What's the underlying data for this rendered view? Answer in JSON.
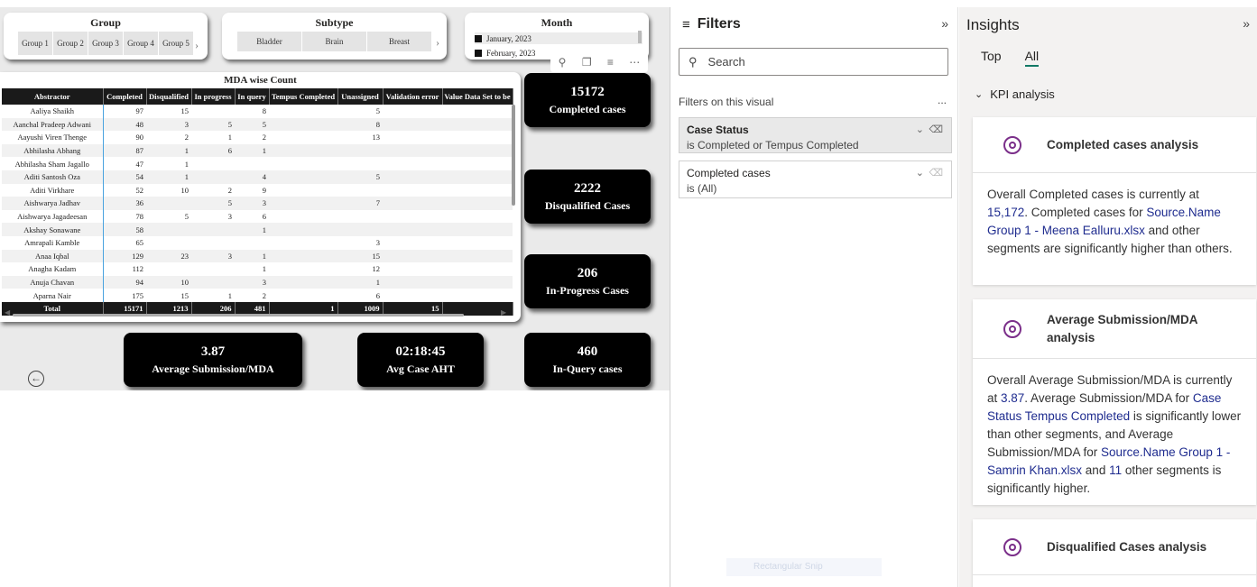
{
  "slicers": {
    "group": {
      "title": "Group",
      "items": [
        "Group 1",
        "Group 2",
        "Group 3",
        "Group 4",
        "Group 5"
      ]
    },
    "subtype": {
      "title": "Subtype",
      "items": [
        "Bladder",
        "Brain",
        "Breast"
      ]
    },
    "month": {
      "title": "Month",
      "items": [
        "January, 2023",
        "February, 2023"
      ]
    }
  },
  "table": {
    "title": "MDA wise Count",
    "columns": [
      "Abstractor",
      "Completed",
      "Disqualified",
      "In progress",
      "In query",
      "Tempus Completed",
      "Unassigned",
      "Validation error",
      "Value Data Set to be"
    ],
    "rows": [
      [
        "Aaliya Shaikh",
        "97",
        "15",
        "",
        "8",
        "",
        "5",
        "",
        ""
      ],
      [
        "Aanchal Pradeep Adwani",
        "48",
        "3",
        "5",
        "5",
        "",
        "8",
        "",
        ""
      ],
      [
        "Aayushi Viren Thenge",
        "90",
        "2",
        "1",
        "2",
        "",
        "13",
        "",
        ""
      ],
      [
        "Abhilasha Abhang",
        "87",
        "1",
        "6",
        "1",
        "",
        "",
        "",
        ""
      ],
      [
        "Abhilasha Sham Jagallo",
        "47",
        "1",
        "",
        "",
        "",
        "",
        "",
        ""
      ],
      [
        "Aditi Santosh Oza",
        "54",
        "1",
        "",
        "4",
        "",
        "5",
        "",
        ""
      ],
      [
        "Aditi Virkhare",
        "52",
        "10",
        "2",
        "9",
        "",
        "",
        "",
        ""
      ],
      [
        "Aishwarya Jadhav",
        "36",
        "",
        "5",
        "3",
        "",
        "7",
        "",
        ""
      ],
      [
        "Aishwarya Jagadeesan",
        "78",
        "5",
        "3",
        "6",
        "",
        "",
        "",
        ""
      ],
      [
        "Akshay Sonawane",
        "58",
        "",
        "",
        "1",
        "",
        "",
        "",
        ""
      ],
      [
        "Amrapali Kamble",
        "65",
        "",
        "",
        "",
        "",
        "3",
        "",
        ""
      ],
      [
        "Anaa Iqbal",
        "129",
        "23",
        "3",
        "1",
        "",
        "15",
        "",
        ""
      ],
      [
        "Anagha Kadam",
        "112",
        "",
        "",
        "1",
        "",
        "12",
        "",
        ""
      ],
      [
        "Anuja Chavan",
        "94",
        "10",
        "",
        "3",
        "",
        "1",
        "",
        ""
      ],
      [
        "Aparna Nair",
        "175",
        "15",
        "1",
        "2",
        "",
        "6",
        "",
        ""
      ]
    ],
    "total": [
      "Total",
      "15171",
      "1213",
      "206",
      "481",
      "1",
      "1009",
      "15",
      ""
    ]
  },
  "kpis": {
    "completed": {
      "value": "15172",
      "label": "Completed cases"
    },
    "disqualified": {
      "value": "2222",
      "label": "Disqualified Cases"
    },
    "in_progress": {
      "value": "206",
      "label": "In-Progress Cases"
    },
    "in_query": {
      "value": "460",
      "label": "In-Query cases"
    },
    "avg_sub": {
      "value": "3.87",
      "label": "Average Submission/MDA"
    },
    "aht": {
      "value": "02:18:45",
      "label": "Avg Case AHT"
    }
  },
  "filters": {
    "title": "Filters",
    "search_placeholder": "Search",
    "section": "Filters on this visual",
    "more": "...",
    "cards": [
      {
        "title": "Case Status",
        "subtitle": "is Completed or Tempus Completed"
      },
      {
        "title": "Completed cases",
        "subtitle": "is (All)"
      }
    ]
  },
  "insights": {
    "title": "Insights",
    "tabs": [
      "Top",
      "All"
    ],
    "section": "KPI analysis",
    "cards": [
      {
        "title": "Completed cases analysis",
        "body": [
          {
            "t": "Overall Completed cases is currently at "
          },
          {
            "t": "15,172",
            "h": true
          },
          {
            "t": ". Completed cases for "
          },
          {
            "t": "Source.Name Group 1 - Meena Ealluru.xlsx",
            "h": true
          },
          {
            "t": " and other segments are significantly higher than others."
          }
        ]
      },
      {
        "title": "Average Submission/MDA analysis",
        "body": [
          {
            "t": "Overall Average Submission/MDA is currently at "
          },
          {
            "t": "3.87",
            "h": true
          },
          {
            "t": ". Average Submission/MDA for "
          },
          {
            "t": "Case Status Tempus Completed",
            "h": true
          },
          {
            "t": " is significantly lower than other segments, and Average Submission/MDA for "
          },
          {
            "t": "Source.Name Group 1 - Samrin Khan.xlsx",
            "h": true
          },
          {
            "t": " and "
          },
          {
            "t": "11",
            "h": true
          },
          {
            "t": " other segments is significantly higher."
          }
        ]
      },
      {
        "title": "Disqualified Cases analysis",
        "body": []
      }
    ]
  },
  "snip_hint": "Rectangular Snip"
}
